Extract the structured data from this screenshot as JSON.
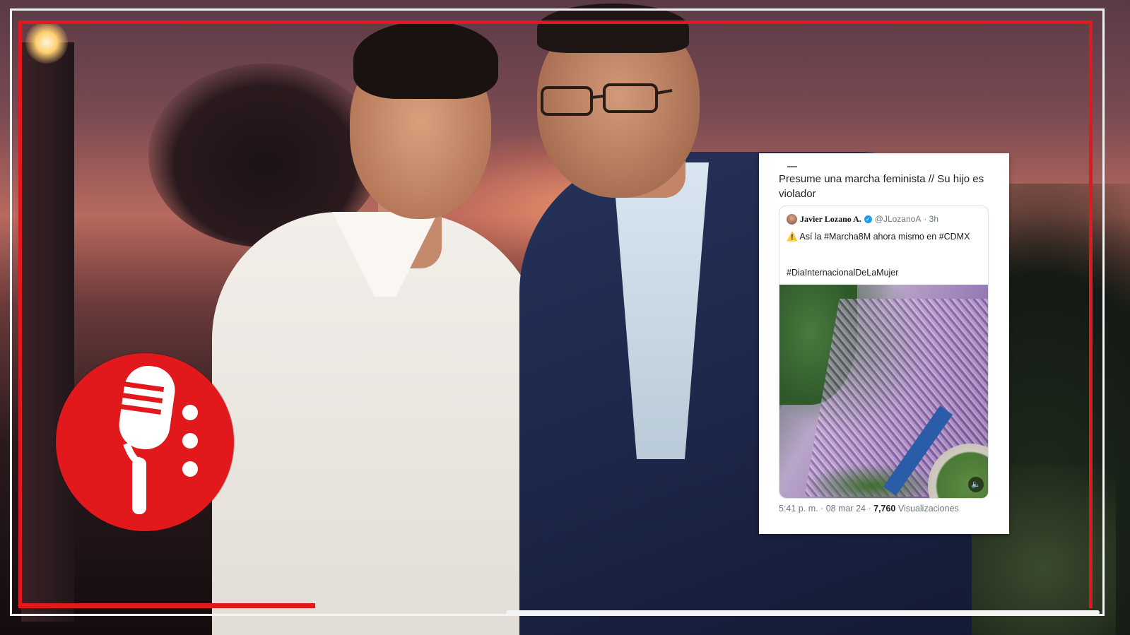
{
  "colors": {
    "accent_red": "#e1191c",
    "frame_white": "#f4f4f4",
    "verified_blue": "#1d9bf0"
  },
  "photo": {
    "logo_icon": "microphone-icon"
  },
  "tweet": {
    "caption": "Presume una marcha feminista // Su hijo es violador",
    "quoted": {
      "author_name": "Javier Lozano A.",
      "verified_icon": "verified-badge-icon",
      "handle": "@JLozanoA",
      "time": "· 3h",
      "warning_icon": "warning-icon",
      "text": "Así la #Marcha8M ahora mismo en #CDMX",
      "hashtag": "#DiaInternacionalDeLaMujer",
      "media_icon": "volume-muted-icon"
    },
    "timestamp": "5:41 p. m. · 08 mar 24 ·",
    "views_count": "7,760",
    "views_label": "Visualizaciones"
  }
}
